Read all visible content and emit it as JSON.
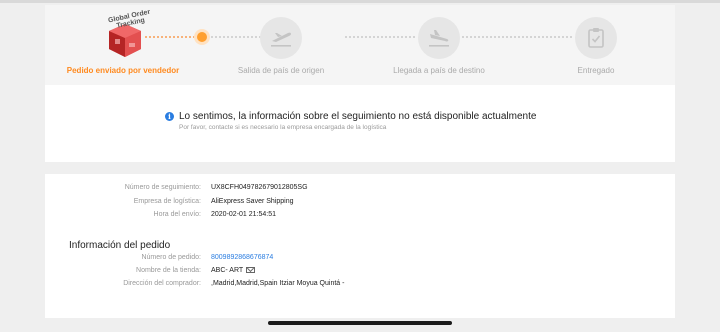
{
  "tracker": {
    "logo_text": "Global Order Tracking",
    "steps": [
      {
        "label": "Pedido enviado por vendedor",
        "icon": "package-cube-icon",
        "state": "active"
      },
      {
        "label": "Salida de país de origen",
        "icon": "plane-takeoff-icon",
        "state": "pending"
      },
      {
        "label": "Llegada a país de destino",
        "icon": "plane-landing-icon",
        "state": "pending"
      },
      {
        "label": "Entregado",
        "icon": "clipboard-check-icon",
        "state": "pending"
      }
    ],
    "accent_color": "#ff8a1f"
  },
  "notice": {
    "icon": "info-icon",
    "title": "Lo sentimos, la información sobre el seguimiento no está disponible actualmente",
    "subtitle": "Por favor, contacte si es necesario la empresa encargada de la logística"
  },
  "shipping": {
    "rows": [
      {
        "label": "Número de seguimiento:",
        "value": "UX8CFH049782679012805SG"
      },
      {
        "label": "Empresa de logística:",
        "value": "AliExpress Saver Shipping"
      },
      {
        "label": "Hora del envío:",
        "value": "2020-02-01 21:54:51"
      }
    ]
  },
  "order": {
    "title": "Información del pedido",
    "rows": [
      {
        "label": "Número de pedido:",
        "value": "8009892868676874"
      },
      {
        "label": "Nombre de la tienda:",
        "value": "ABC- ART"
      },
      {
        "label": "Dirección del comprador:",
        "value": ",Madrid,Madrid,Spain Itziar Moyua Quintá -"
      }
    ]
  }
}
